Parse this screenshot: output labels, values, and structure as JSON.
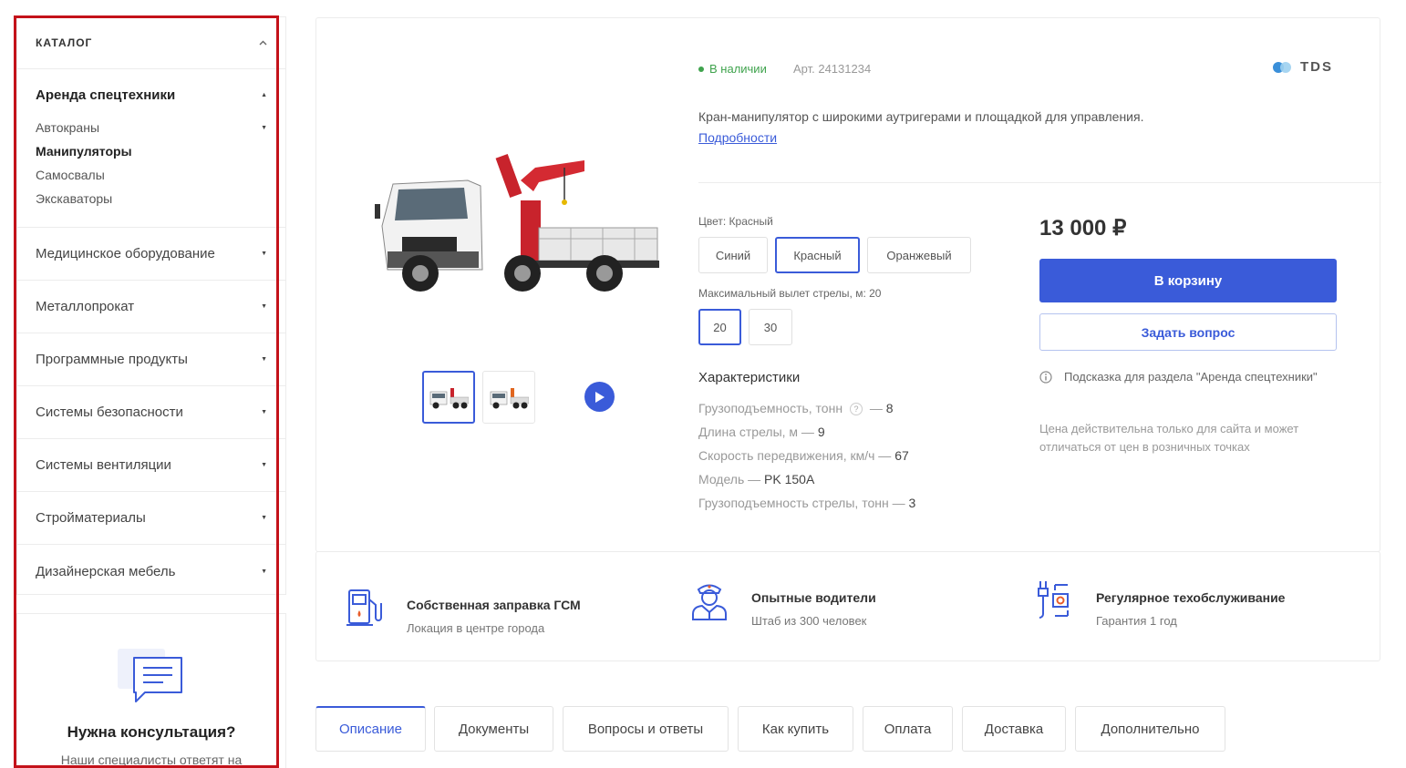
{
  "sidebar": {
    "title": "КАТАЛОГ",
    "open_section": {
      "title": "Аренда спецтехники",
      "items": [
        {
          "label": "Автокраны"
        },
        {
          "label": "Манипуляторы"
        },
        {
          "label": "Самосвалы"
        },
        {
          "label": "Экскаваторы"
        }
      ]
    },
    "sections": [
      {
        "label": "Медицинское оборудование"
      },
      {
        "label": "Металлопрокат"
      },
      {
        "label": "Программные продукты"
      },
      {
        "label": "Системы безопасности"
      },
      {
        "label": "Системы вентиляции"
      },
      {
        "label": "Стройматериалы"
      },
      {
        "label": "Дизайнерская мебель"
      }
    ]
  },
  "consult": {
    "title": "Нужна консультация?",
    "text": "Наши специалисты ответят на"
  },
  "product": {
    "stock": "В наличии",
    "sku": "Арт. 24131234",
    "brand": "TDS",
    "description": "Кран-манипулятор с широкими аутригерами и площадкой для управления.",
    "more_link": "Подробности",
    "color_label": "Цвет: Красный",
    "colors": [
      "Синий",
      "Красный",
      "Оранжевый"
    ],
    "boom_label": "Максимальный вылет стрелы, м: 20",
    "booms": [
      "20",
      "30"
    ],
    "chars_title": "Характеристики",
    "chars": [
      {
        "name": "Грузоподъемность, тонн",
        "value": "8"
      },
      {
        "name": "Длина стрелы, м",
        "value": "9"
      },
      {
        "name": "Скорость передвижения, км/ч",
        "value": "67"
      },
      {
        "name": "Модель",
        "value": "PK 150A"
      },
      {
        "name": "Грузоподъемность стрелы, тонн",
        "value": "3"
      }
    ],
    "char_help": "?",
    "char_sep": " — ",
    "price": "13 000 ₽",
    "cart_button": "В корзину",
    "ask_button": "Задать вопрос",
    "hint": "Подсказка для раздела \"Аренда спецтехники\"",
    "note": "Цена действительна только для сайта и может отличаться от цен в розничных точках"
  },
  "features": [
    {
      "title": "Собственная заправка ГСМ",
      "subtitle": "Локация в центре города",
      "icon": "fuel-station-icon"
    },
    {
      "title": "Опытные водители",
      "subtitle": "Штаб из 300 человек",
      "icon": "driver-icon"
    },
    {
      "title": "Регулярное техобслуживание",
      "subtitle": "Гарантия 1 год",
      "icon": "wrench-icon"
    }
  ],
  "tabs": [
    "Описание",
    "Документы",
    "Вопросы и ответы",
    "Как купить",
    "Оплата",
    "Доставка",
    "Дополнительно"
  ],
  "colors": {
    "accent": "#3a5bd9",
    "in_stock": "#3fa34d",
    "highlight_frame": "#c4121a"
  }
}
